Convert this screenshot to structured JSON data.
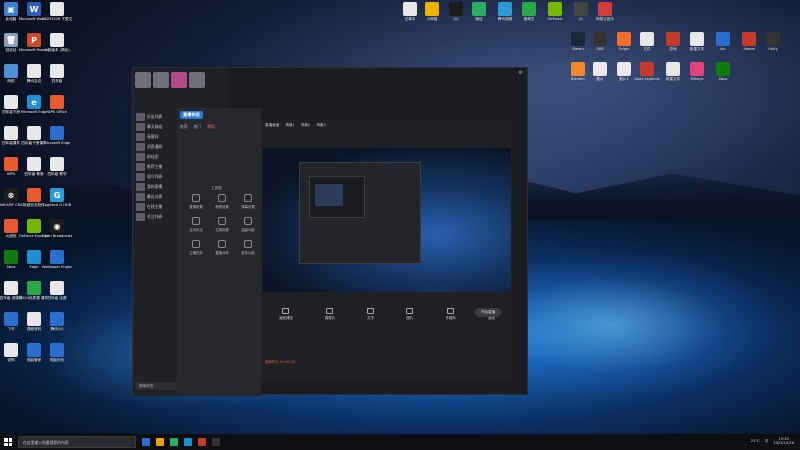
{
  "desktop_icons_left": [
    {
      "label": "此电脑",
      "color": "#3c7bd6",
      "glyph": "▣"
    },
    {
      "label": "Microsoft Word 2019",
      "color": "#2b5fb7",
      "glyph": "W"
    },
    {
      "label": "20231026 下载文件",
      "color": "#e8e8e8",
      "glyph": ""
    },
    {
      "label": "回收站",
      "color": "#8aa0b8",
      "glyph": "🗑"
    },
    {
      "label": "Microsoft PowerPoint",
      "color": "#d24726",
      "glyph": "P"
    },
    {
      "label": "人民版本 (简化)",
      "color": "#e8e8e8",
      "glyph": ""
    },
    {
      "label": "网络",
      "color": "#4f8fd6",
      "glyph": ""
    },
    {
      "label": "腾讯会议",
      "color": "#e8e8e8",
      "glyph": ""
    },
    {
      "label": "四年级",
      "color": "#e8e8e8",
      "glyph": ""
    },
    {
      "label": "四年级下册",
      "color": "#e8e8e8",
      "glyph": ""
    },
    {
      "label": "Microsoft Edge",
      "color": "#1e8fd6",
      "glyph": "e"
    },
    {
      "label": "WPS Office",
      "color": "#e8592b",
      "glyph": ""
    },
    {
      "label": "四年级课件",
      "color": "#e8e8e8",
      "glyph": ""
    },
    {
      "label": "四年级下册课件",
      "color": "#e8e8e8",
      "glyph": ""
    },
    {
      "label": "Microsoft Edge",
      "color": "#2a6fd0",
      "glyph": ""
    },
    {
      "label": "WPS",
      "color": "#e8592b",
      "glyph": ""
    },
    {
      "label": "四年级 教案",
      "color": "#e8e8e8",
      "glyph": ""
    },
    {
      "label": "四年级 教学",
      "color": "#e8e8e8",
      "glyph": ""
    },
    {
      "label": "ARMOURY CRATE",
      "color": "#1c1c1c",
      "glyph": "⊗"
    },
    {
      "label": "火绒安全软件",
      "color": "#e8592b",
      "glyph": ""
    },
    {
      "label": "Logitech G HUB",
      "color": "#2a9bd6",
      "glyph": "G"
    },
    {
      "label": "火绒剑",
      "color": "#e8592b",
      "glyph": ""
    },
    {
      "label": "GeForce Experience",
      "color": "#76b900",
      "glyph": ""
    },
    {
      "label": "Open Broadcaster",
      "color": "#1c1c1c",
      "glyph": "◉"
    },
    {
      "label": "Xbox",
      "color": "#107c10",
      "glyph": ""
    },
    {
      "label": "Edge",
      "color": "#1e8fd6",
      "glyph": ""
    },
    {
      "label": "Wallpaper Engine",
      "color": "#2a6fd0",
      "glyph": ""
    },
    {
      "label": "四年级 说课稿",
      "color": "#e8e8e8",
      "glyph": ""
    },
    {
      "label": "2024优质课 课件",
      "color": "#2aa84a",
      "glyph": ""
    },
    {
      "label": "四年级 比赛",
      "color": "#e8e8e8",
      "glyph": ""
    },
    {
      "label": "飞书",
      "color": "#2a6fd0",
      "glyph": ""
    },
    {
      "label": "课程资料",
      "color": "#e8e8e8",
      "glyph": ""
    },
    {
      "label": "腾讯QQ",
      "color": "#2a6fd0",
      "glyph": ""
    },
    {
      "label": "说明",
      "color": "#e8e8e8",
      "glyph": ""
    },
    {
      "label": "电脑管家",
      "color": "#2a6fd0",
      "glyph": ""
    },
    {
      "label": "电脑优化",
      "color": "#2a6fd0",
      "glyph": ""
    }
  ],
  "desktop_icons_right": [
    {
      "label": "记事本",
      "color": "#e8e8e8"
    },
    {
      "label": "小熊猫",
      "color": "#f0b400"
    },
    {
      "label": "QQ",
      "color": "#1c1c1c"
    },
    {
      "label": "微信",
      "color": "#2aae67"
    },
    {
      "label": "腾讯视频",
      "color": "#2a9bd6"
    },
    {
      "label": "爱奇艺",
      "color": "#2aa84a"
    },
    {
      "label": "GeForce",
      "color": "#76b900"
    },
    {
      "label": "JS",
      "color": "#444"
    },
    {
      "label": "网易云音乐",
      "color": "#d23c3c"
    },
    {
      "label": "Steam",
      "color": "#1b2838"
    },
    {
      "label": "OBS",
      "color": "#333"
    },
    {
      "label": "Origin",
      "color": "#f56c2d"
    },
    {
      "label": "文件",
      "color": "#e8e8e8"
    },
    {
      "label": "游戏",
      "color": "#c23a2a"
    },
    {
      "label": "新建文本",
      "color": "#e8e8e8"
    },
    {
      "label": "Arc",
      "color": "#2a6fd0"
    },
    {
      "label": "Adobe",
      "color": "#c23a2a"
    },
    {
      "label": "Unity",
      "color": "#333"
    },
    {
      "label": "Blender",
      "color": "#f08a2a"
    },
    {
      "label": "图片",
      "color": "#e8e8e8"
    },
    {
      "label": "图片2",
      "color": "#e8e8e8"
    },
    {
      "label": "Apex Legends",
      "color": "#c23a2a"
    },
    {
      "label": "新建文件",
      "color": "#e8e8e8"
    },
    {
      "label": "Mihoyo",
      "color": "#e0447a"
    },
    {
      "label": "Xbox",
      "color": "#107c10"
    }
  ],
  "app": {
    "brand": "直播伴侣",
    "title_icon": "gear-icon",
    "tabs": [
      "推荐",
      "热门",
      "常用"
    ],
    "side_rows": [
      "好友列表",
      "聊天群组",
      "直播间",
      "消息通知",
      "粉丝团",
      "推荐主播",
      "观众列表",
      "我的直播",
      "最近访客",
      "在线主播",
      "关注列表"
    ],
    "search_placeholder": "搜索好友",
    "tools": [
      "直播设置",
      "画质设置",
      "弹幕设置",
      "互动玩法",
      "礼物设置",
      "高级功能",
      "主播任务",
      "直播分析",
      "更多功能"
    ],
    "panel_label": "工具箱",
    "stage_tabs": [
      "直播画面",
      "场景1",
      "场景2",
      "场景3"
    ],
    "controls": [
      "画面捕捉",
      "摄像头",
      "文字",
      "图片",
      "多媒体",
      "音频"
    ],
    "start_live": "开始直播",
    "footer_note": "直播时长 00:00:00"
  },
  "taskbar": {
    "search_placeholder": "在这里输入你要搜索的内容",
    "time": "19:30",
    "date": "2023/10/26",
    "temp": "21°C",
    "lang": "中"
  }
}
